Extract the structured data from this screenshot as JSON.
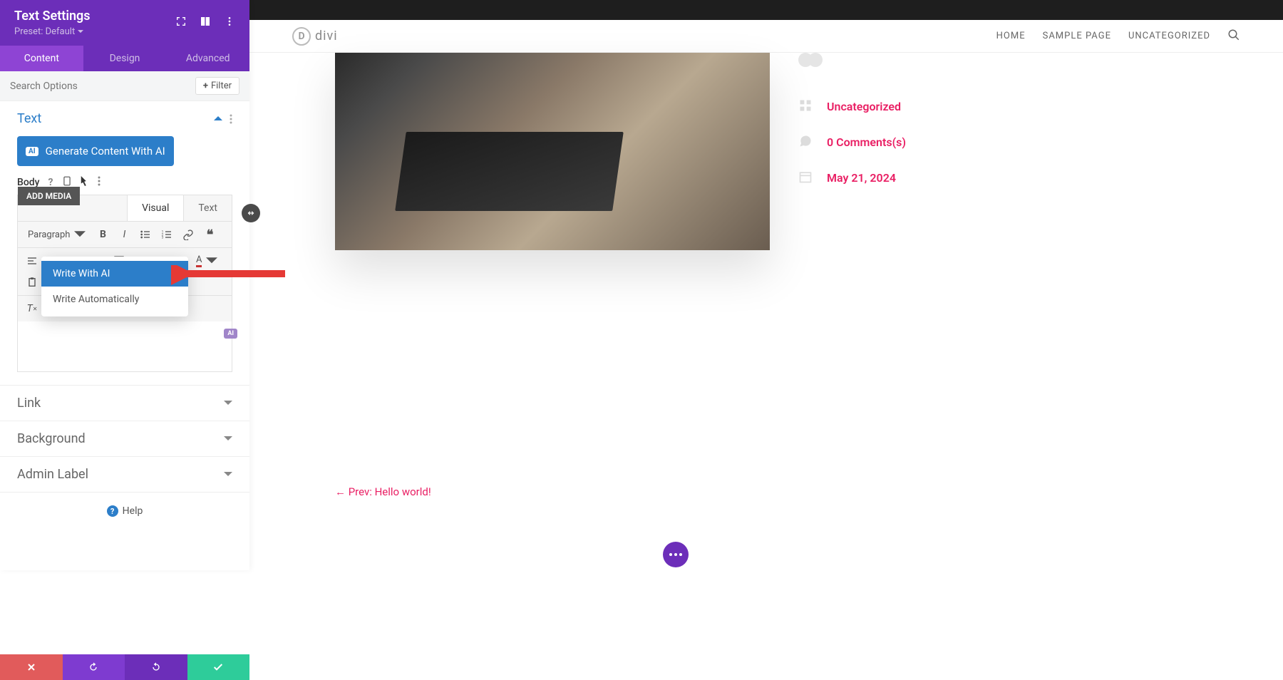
{
  "sidebar": {
    "title": "Text Settings",
    "preset": "Preset: Default",
    "tabs": {
      "content": "Content",
      "design": "Design",
      "advanced": "Advanced"
    },
    "search_placeholder": "Search Options",
    "filter": "Filter",
    "sections": {
      "text": "Text",
      "link": "Link",
      "background": "Background",
      "admin_label": "Admin Label"
    },
    "gen_ai": "Generate Content With AI",
    "body_label": "Body",
    "add_media": "ADD MEDIA",
    "editor_tabs": {
      "visual": "Visual",
      "text": "Text"
    },
    "paragraph": "Paragraph",
    "dropdown": {
      "write_ai": "Write With AI",
      "write_auto": "Write Automatically"
    },
    "help": "Help"
  },
  "site": {
    "logo_text": "divi",
    "nav": {
      "home": "HOME",
      "sample": "SAMPLE PAGE",
      "uncat": "UNCATEGORIZED"
    },
    "meta": {
      "category": "Uncategorized",
      "comments": "0 Comments(s)",
      "date": "May 21, 2024"
    },
    "prev_link": "← Prev: Hello world!"
  },
  "colors": {
    "purple": "#6c2eb9",
    "blue": "#2c7ec9",
    "pink": "#e91e63",
    "green": "#2ecc9a"
  }
}
